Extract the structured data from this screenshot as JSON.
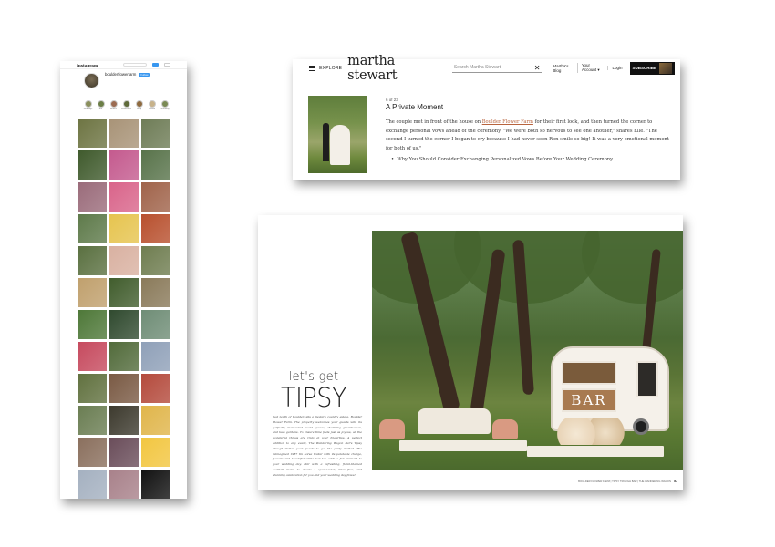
{
  "instagram": {
    "brand": "Instagram",
    "username": "boulderflowerfarm",
    "follow_label": "Follow",
    "stats": "",
    "display_name": "",
    "bio": "",
    "highlights": [
      {
        "label": "Weddings",
        "color": "#8a8f5c"
      },
      {
        "label": "Bar",
        "color": "#6c7e47"
      },
      {
        "label": "Brunch",
        "color": "#9b6b52"
      },
      {
        "label": "Workshops",
        "color": "#5f6b3b"
      },
      {
        "label": "Shop",
        "color": "#8e6a3f"
      },
      {
        "label": "Garden",
        "color": "#c7b28a"
      },
      {
        "label": "Ceremony",
        "color": "#7a8a55"
      }
    ],
    "grid_colors": [
      "#6d7442",
      "#a89377",
      "#6e7c56",
      "#3f5a2c",
      "#c45a8e",
      "#58734a",
      "#9a6b7a",
      "#d9648a",
      "#a0634a",
      "#5e7a4a",
      "#e6c44f",
      "#b8502e",
      "#5a7040",
      "#d9b1a1",
      "#6f7d50",
      "#c0a06d",
      "#415d2d",
      "#8a7a5a",
      "#4e7838",
      "#304a2f",
      "#6f8d76",
      "#c64a5e",
      "#526b3b",
      "#8fa0b8",
      "#61713f",
      "#7a5a44",
      "#b44a3c",
      "#6a7d52",
      "#3d3a2e",
      "#e0b54a",
      "#8a6f5d",
      "#6a4d5a",
      "#f2c640",
      "#a4b0c0",
      "#a8818a",
      "#111111",
      "#4a6a3a",
      "#eae6e0",
      "#7f9b6c",
      "#5a6848",
      "#7c7fa6",
      "#567a45"
    ]
  },
  "martha": {
    "explore_label": "EXPLORE",
    "logo": "martha stewart",
    "search_placeholder": "Search Martha Stewart",
    "links": [
      "Martha's Blog",
      "Your Account ▾",
      "Login"
    ],
    "subscribe_label": "SUBSCRIBE",
    "slide_count": "6 of 23",
    "slide_title": "A Private Moment",
    "para_part1": "The couple met in front of the house on ",
    "para_link": "Boulder Flower Farm",
    "para_part2": " for their first look, and then turned the corner to exchange personal vows ahead of the ceremony. \"We were both so nervous to see one another,\" shares Elle. \"The second I turned the corner I began to cry because I had never seen Ron smile so big! It was a very emotional moment for both of us.\"",
    "bullet": "Why You Should Consider Exchanging Personalized Vows Before Your Wedding Ceremony"
  },
  "spread": {
    "lets_get": "let's get",
    "headline": "TIPSY",
    "story": "Just north of Boulder, sits a modern country estate, Boulder Flower Farm. The property welcomes your guests with its perfectly manicured event spaces, charming greenhouses, and lush gardens. To ensure time feels just as joyous, all the wonderful things are truly at your fingertips. A perfect addition to any event, The Wandering Wagon Bar's Tipsy Trough invites your guests to get the party started. The reimagined 1987 tin horse trailer with its palatable charge, flowers and beautiful white bar top adds a fun element to your wedding day. Pair with a refreshing, floral-themed cocktail menu to create a spectacular, stress-free, and stunning celebration for you and your wedding day flows!",
    "trailer_sign": "BAR",
    "footer_text": "BOULDER FLOWER FARM | TIPSY TROUGH BAR | THE WANDERING WAGON",
    "page_number": "57"
  }
}
